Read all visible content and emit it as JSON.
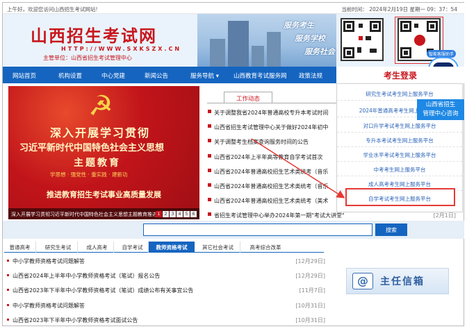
{
  "topbar": {
    "welcome": "上午好，欢迎您访问山西招生考试网站!",
    "time": "当前时间： 2024年2月19日 星期一 09：37：54"
  },
  "header": {
    "site_name": "山西招生考试网",
    "url": "HTTP://WWW.SXKSZX.CN",
    "sponsor": "主管单位：山西省招生考试管理中心",
    "slogans": [
      "服务考生",
      "服务学校",
      "服务社会"
    ],
    "robot_tag": "智能客服助手"
  },
  "nav": {
    "items": [
      "网站首页",
      "机构设置",
      "中心党建",
      "新闻公告",
      "服务导航 ▾",
      "山西教育考试服务网",
      "政策法规"
    ],
    "login": "考生登录"
  },
  "banner": {
    "line1": "深入开展学习贯彻",
    "line2": "习近平新时代中国特色社会主义思想",
    "line3": "主题教育",
    "line4": "学思想 · 强党性 · 重实践 · 建新功",
    "line5": "推进教育招生考试事业高质量发展",
    "caption": "深入开展学习贯彻习近平新时代中国特色社会主义思想主题教育推进…",
    "pages": [
      "1",
      "2",
      "3",
      "4",
      "5",
      "6"
    ]
  },
  "news": {
    "tab": "工作动态",
    "items": [
      {
        "title": "关于调整我省2024年普通高校专升本考试时间",
        "date": ""
      },
      {
        "title": "山西省招生考试管理中心关于做好2024年初中",
        "date": ""
      },
      {
        "title": "关于调整考生档案查询服务时间的公告",
        "date": ""
      },
      {
        "title": "山西省2024年上半年高等教育自学考试首次",
        "date": ""
      },
      {
        "title": "山西省2024年普通高校招生艺术类统考（音乐",
        "date": ""
      },
      {
        "title": "山西省2024年普通高校招生艺术类统考（音乐",
        "date": ""
      },
      {
        "title": "山西省2024年普通高校招生艺术类统考（美术",
        "date": ""
      },
      {
        "title": "省招生考试管理中心举办2024年第一期\"考试大讲堂\"",
        "date": "[2月1日]"
      }
    ]
  },
  "panel": {
    "options": [
      "研究生考试考生网上服务平台",
      "2024年普通高考考生网上服务平台",
      "对口升学考试考生网上服务平台",
      "专升本考试考生网上服务平台",
      "学业水平考试考生网上服务平台",
      "中考考生网上服务平台",
      "成人高考考生网上服务平台",
      "自学考试考生网上服务平台"
    ]
  },
  "chat": {
    "line1": "山西省招生",
    "line2": "管理中心咨询"
  },
  "search": {
    "placeholder": "",
    "button": "搜索"
  },
  "tabs": [
    "普通高考",
    "研究生考试",
    "成人高考",
    "自学考试",
    "教师资格考试",
    "其它社会考试",
    "高考综合改革"
  ],
  "list": [
    {
      "title": "中小学教师资格考试问题解答",
      "date": "[12月29日]"
    },
    {
      "title": "山西省2024年上半年中小学教师资格考试（笔试）报名公告",
      "date": "[12月29日]"
    },
    {
      "title": "山西省2023年下半年中小学教师资格考试（笔试）成绩公布有关事宜公告",
      "date": "[11月7日]"
    },
    {
      "title": "中小学教师资格考试问题解答",
      "date": "[10月31日]"
    },
    {
      "title": "山西省2023年下半年中小学教师资格考试面试公告",
      "date": "[10月31日]"
    }
  ],
  "mailbox": {
    "icon": "@",
    "label": "主任信箱"
  },
  "colors": {
    "brand_red": "#c8161d",
    "nav_blue": "#1565c0",
    "highlight": "#e53935"
  }
}
